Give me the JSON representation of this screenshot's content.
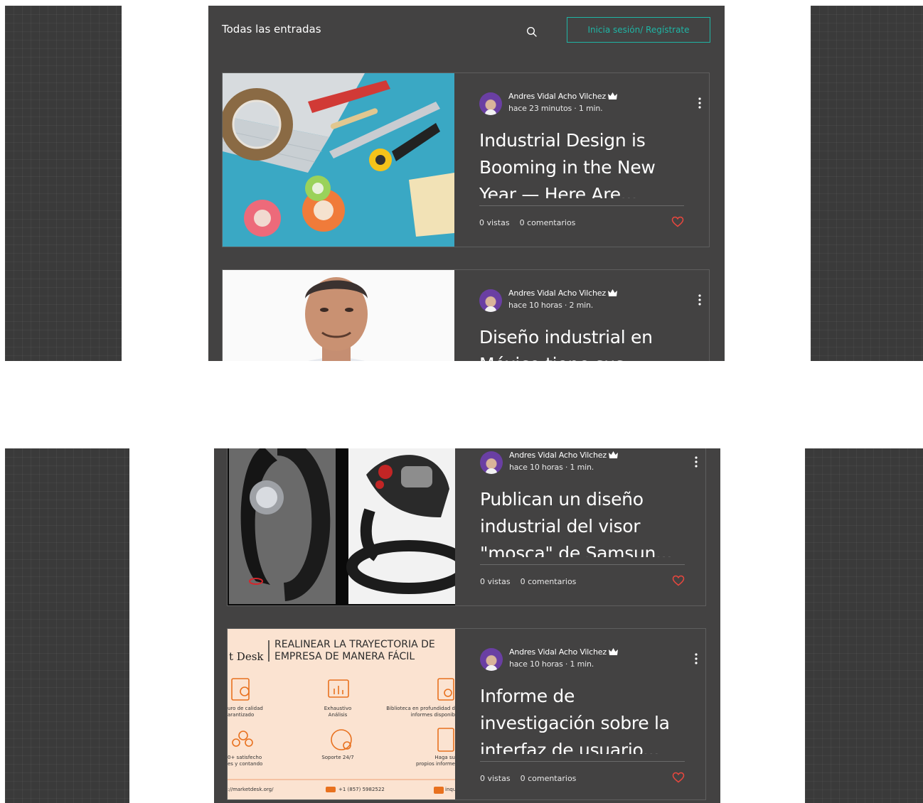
{
  "header": {
    "title": "Todas las entradas",
    "login_label": "Inicia sesión/ Regístrate"
  },
  "posts": [
    {
      "author": "Andres Vidal Acho Vilchez",
      "time": "hace 23 minutos",
      "read": "1 min.",
      "title": "Industrial Design is Booming in the New Year — Here Are...",
      "views": "0 vistas",
      "comments": "0 comentarios"
    },
    {
      "author": "Andres Vidal Acho Vilchez",
      "time": "hace 10 horas",
      "read": "2 min.",
      "title": "Diseño industrial en México tiene sus",
      "views": "",
      "comments": ""
    },
    {
      "author": "Andres Vidal Acho Vilchez",
      "time": "hace 10 horas",
      "read": "1 min.",
      "title": "Publican un diseño industrial del visor \"mosca\" de Samsun...",
      "views": "0 vistas",
      "comments": "0 comentarios"
    },
    {
      "author": "Andres Vidal Acho Vilchez",
      "time": "hace 10 horas",
      "read": "1 min.",
      "title": "Informe de investigación sobre la interfaz de usuario...",
      "views": "0 vistas",
      "comments": "0 comentarios"
    }
  ],
  "ad": {
    "brand": "t Desk",
    "headline_1": "REALINEAR LA TRAYECTORIA DE",
    "headline_2": "EMPRESA DE MANERA FÁCIL",
    "f1_1": "uro de calidad",
    "f1_2": "arantizado",
    "f2_1": "Exhaustivo",
    "f2_2": "Análisis",
    "f3_1": "Biblioteca en profundidad d",
    "f3_2": "informes disponib",
    "f4_1": "0+ satisfecho",
    "f4_2": "es y contando",
    "f5_1": "Soporte 24/7",
    "f6_1": "Haga su",
    "f6_2": "propios informe",
    "url": "://marketdesk.org/",
    "phone": "+1 (857) 5982522",
    "email": "inquiry@"
  },
  "colors": {
    "background": "#434242",
    "accent": "#1fb5a5",
    "heart": "#e8473e"
  }
}
